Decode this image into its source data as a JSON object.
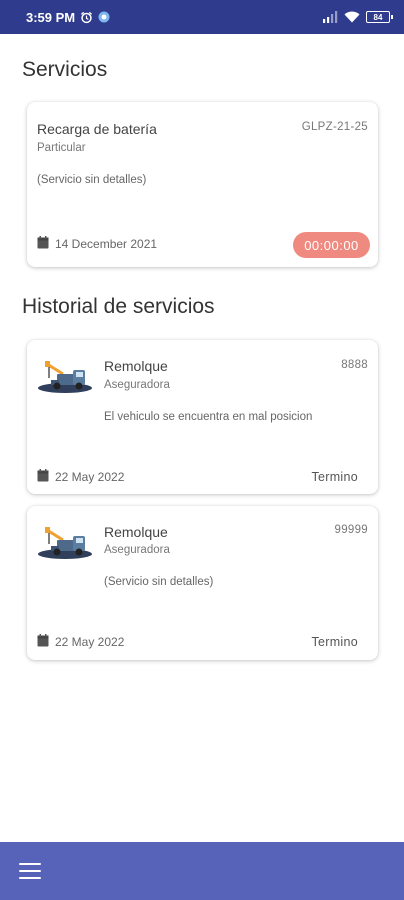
{
  "status_bar": {
    "time": "3:59 PM",
    "icons": [
      "alarm-icon",
      "sync-icon",
      "signal-icon",
      "wifi-icon"
    ],
    "battery": "84"
  },
  "sections": {
    "servicios_title": "Servicios",
    "historial_title": "Historial de servicios"
  },
  "active_service": {
    "title": "Recarga de batería",
    "subtitle": "Particular",
    "code": "GLPZ-21-25",
    "details": "(Servicio sin detalles)",
    "date": "14 December 2021",
    "timer": "00:00:00"
  },
  "history": [
    {
      "title": "Remolque",
      "subtitle": "Aseguradora",
      "code": "8888",
      "details": "El vehiculo se encuentra en mal posicion",
      "date": "22 May 2022",
      "status": "Termino"
    },
    {
      "title": "Remolque",
      "subtitle": "Aseguradora",
      "code": "99999",
      "details": "(Servicio sin detalles)",
      "date": "22 May 2022",
      "status": "Termino"
    }
  ],
  "colors": {
    "status_bar": "#2f3b8c",
    "bottom_bar": "#5763b8",
    "timer_badge": "#ef8a80"
  },
  "bottom_bar": {
    "menu_icon": "hamburger-menu-icon"
  }
}
